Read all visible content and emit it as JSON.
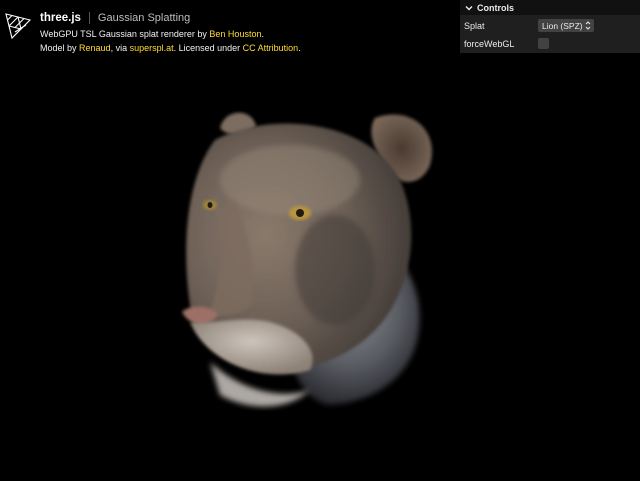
{
  "header": {
    "title": "three.js",
    "subtitle": "Gaussian Splatting",
    "line1_prefix": "WebGPU TSL Gaussian splat renderer by ",
    "line1_link": "Ben Houston",
    "line1_suffix": ".",
    "line2_prefix": "Model by ",
    "line2_link1": "Renaud",
    "line2_mid1": ", via ",
    "line2_link2": "superspl.at",
    "line2_mid2": ". Licensed under ",
    "line2_link3": "CC Attribution",
    "line2_suffix": "."
  },
  "controls": {
    "title": "Controls",
    "splat_label": "Splat",
    "splat_value": "Lion (SPZ)",
    "webgl_label": "forceWebGL",
    "webgl_checked": false
  },
  "icons": {
    "logo": "threejs-logo-icon",
    "chevron": "chevron-down-icon",
    "select": "select-arrows-icon"
  },
  "colors": {
    "background": "#000000",
    "link": "#ffdd33",
    "panel": "#1f1f1f",
    "panel_title": "#111111",
    "widget": "#424242"
  }
}
